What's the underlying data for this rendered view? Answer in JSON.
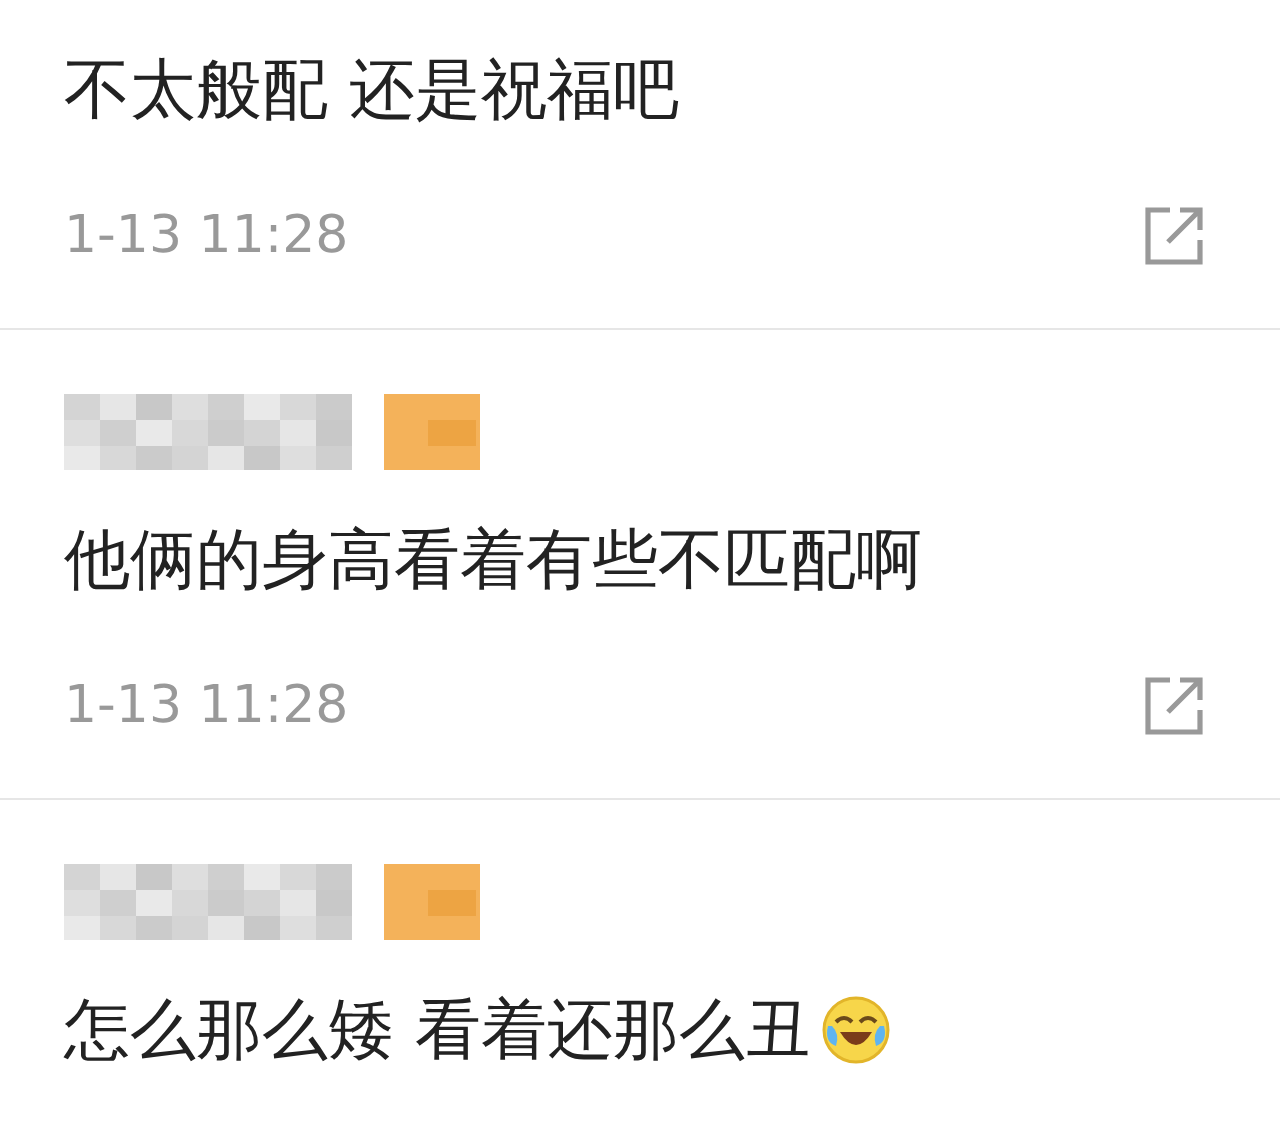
{
  "comments": [
    {
      "name_redacted": false,
      "text": "不太般配 还是祝福吧",
      "trailing_emoji": false,
      "time": "1-13 11:28"
    },
    {
      "name_redacted": true,
      "text": "他俩的身高看着有些不匹配啊",
      "trailing_emoji": false,
      "time": "1-13 11:28"
    },
    {
      "name_redacted": true,
      "text": "怎么那么矮 看着还那么丑",
      "trailing_emoji": true
    }
  ]
}
